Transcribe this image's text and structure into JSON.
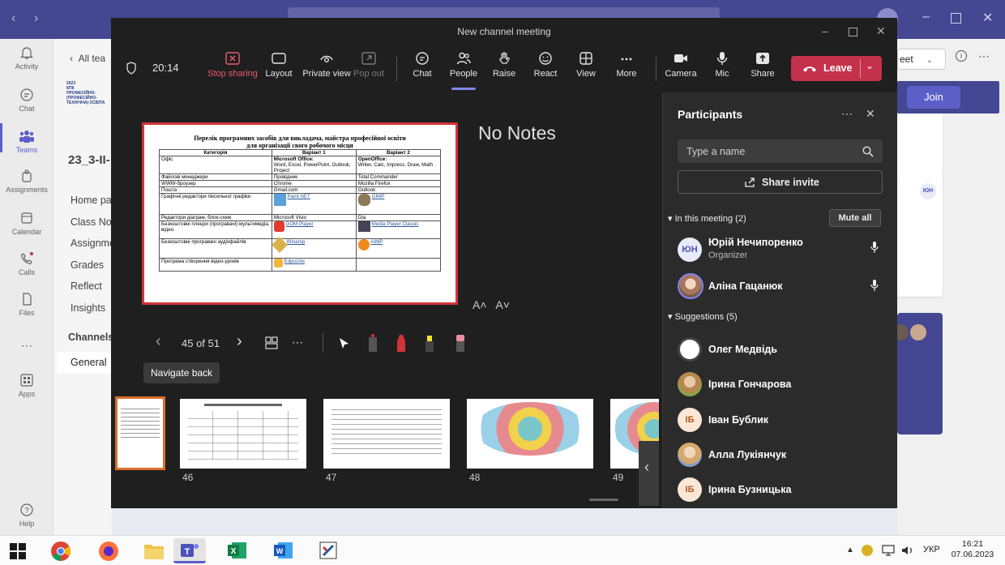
{
  "teams": {
    "back_label": "All tea",
    "team_name": "23_3-II-",
    "team_logo_text": [
      "2023",
      "КПК",
      "ПРОФЕСІЙНО-",
      "(ПРОФЕСІЙНО-",
      "ТЕХНІЧНА) ОСВІТА"
    ],
    "nav": [
      "Home pa",
      "Class No",
      "Assignme",
      "Grades",
      "Reflect",
      "Insights"
    ],
    "channels_label": "Channels",
    "channel_general": "General",
    "rail": [
      "Activity",
      "Chat",
      "Teams",
      "Assignments",
      "Calendar",
      "Calls",
      "Files",
      "Apps",
      "Help"
    ],
    "join_label": "Join",
    "meet_label": "eet",
    "right_avatar": "ЮН"
  },
  "meeting": {
    "window_title": "New channel meeting",
    "timer": "20:14",
    "toolbar": {
      "stop_sharing": "Stop sharing",
      "layout": "Layout",
      "private_view": "Private view",
      "pop_out": "Pop out",
      "chat": "Chat",
      "people": "People",
      "raise": "Raise",
      "react": "React",
      "view": "View",
      "more": "More",
      "camera": "Camera",
      "mic": "Mic",
      "share": "Share",
      "leave": "Leave"
    },
    "notes": "No Notes",
    "font_up": "A˄",
    "font_down": "A˅",
    "page_counter": "45 of 51",
    "tooltip": "Navigate back",
    "thumbs": [
      "",
      "46",
      "47",
      "48",
      "49"
    ],
    "slide": {
      "title_line1": "Перелік програмних засобів для викладача, майстра професійної освіти",
      "title_line2": "для організації свого робочого місця",
      "headers": [
        "Категорія",
        "Варіант 1",
        "Варіант 2"
      ],
      "rows": [
        [
          "Офіс",
          "Microsoft Office:",
          "OpenOffice:"
        ],
        [
          "",
          "Word, Excel, PowerPoint, Outlook, Project",
          "Writer, Calc, Impress, Draw, Math"
        ],
        [
          "Файлові менеджери",
          "Провідник",
          "Total Commander"
        ],
        [
          "WWW-броузер",
          "Chrome",
          "Mozilla Firefox"
        ],
        [
          "Пошта",
          "Gmail.com",
          "Outlook"
        ],
        [
          "Графічні редактори піксельної графіки",
          "Paint.NET",
          "GIMP"
        ],
        [
          "Редактори діаграм, блок-схем",
          "Microsoft Visio",
          "Dia"
        ],
        [
          "Безкоштовні плеєри (програвачі) мультимедіа, відео",
          "GOM Player",
          "Media Player Classic"
        ],
        [
          "Безкоштовні програвачі аудіофайлів",
          "Winamp",
          "AIMP"
        ],
        [
          "Програма створення відео-уроків",
          "Edpuzzle",
          ""
        ]
      ]
    }
  },
  "participants": {
    "title": "Participants",
    "search_placeholder": "Type a name",
    "share_invite": "Share invite",
    "in_meeting_label": "In this meeting (2)",
    "mute_all": "Mute all",
    "in_meeting": [
      {
        "initials": "ЮН",
        "name": "Юрій Нечипоренко",
        "role": "Organizer"
      },
      {
        "initials": "",
        "name": "Аліна Гацанюк",
        "role": ""
      }
    ],
    "suggestions_label": "Suggestions (5)",
    "suggestions": [
      {
        "initials": "",
        "name": "Олег Медвідь"
      },
      {
        "initials": "",
        "name": "Ірина Гончарова"
      },
      {
        "initials": "ІБ",
        "name": "Іван Бублик"
      },
      {
        "initials": "",
        "name": "Алла Лукіянчук"
      },
      {
        "initials": "ІБ",
        "name": "Ірина Бузницька"
      }
    ]
  },
  "taskbar": {
    "language": "УКР",
    "time": "16:21",
    "date": "07.06.2023"
  },
  "colors": {
    "teams_purple": "#444791",
    "leave_red": "#c4314b",
    "slide_border": "#d13438"
  }
}
